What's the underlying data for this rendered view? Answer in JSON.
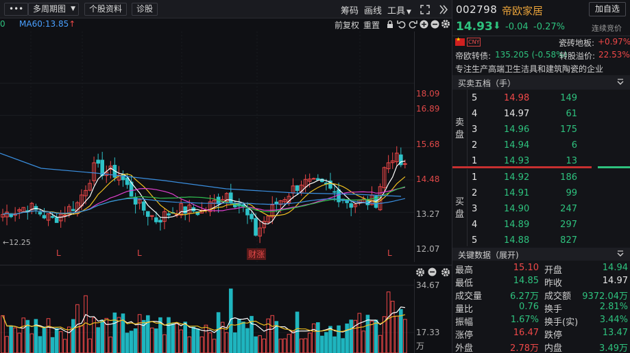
{
  "toolbar": {
    "menu_label": "•••",
    "period_label": "多周期图",
    "profile_label": "个股资料",
    "diagnose_label": "诊股",
    "chip_label": "筹码",
    "draw_label": "画线",
    "tools_label": "工具"
  },
  "ma_bar": {
    "ma_prev": "0",
    "ma60": "MA60:13.85"
  },
  "subbar": {
    "restore": "前复权",
    "reset": "重置"
  },
  "price_axis": [
    "18.09",
    "16.89",
    "15.68",
    "14.48",
    "13.27",
    "12.07"
  ],
  "low_marker": "←12.25",
  "event_markers": [
    "L",
    "L",
    "财涨",
    "L"
  ],
  "volume_axis": [
    "34.67",
    "17.33",
    "万"
  ],
  "quote": {
    "code": "002798",
    "name": "帝欧家居",
    "price": "14.93",
    "change": "-0.04",
    "change_pct": "-0.27%",
    "add_button": "加自选",
    "auction": "连续竞价",
    "sector_label": "瓷砖地板:",
    "sector_change": "+0.97%",
    "currency": "CNY",
    "bond_label": "帝欧转债:",
    "bond_value": "135.205 (-0.58%)",
    "premium_label": "转股溢价:",
    "premium_value": "22.53%",
    "desc": "专注生产高端卫生洁具和建筑陶瓷的企业"
  },
  "orderbook": {
    "title": "买卖五档（手）",
    "sell_label": "卖盘",
    "buy_label": "买盘",
    "sell": [
      {
        "lvl": "5",
        "price": "14.98",
        "vol": "149",
        "pc": "red"
      },
      {
        "lvl": "4",
        "price": "14.97",
        "vol": "61",
        "pc": "wht"
      },
      {
        "lvl": "3",
        "price": "14.96",
        "vol": "175",
        "pc": "grn"
      },
      {
        "lvl": "2",
        "price": "14.94",
        "vol": "6",
        "pc": "grn"
      },
      {
        "lvl": "1",
        "price": "14.93",
        "vol": "13",
        "pc": "grn"
      }
    ],
    "buy": [
      {
        "lvl": "1",
        "price": "14.92",
        "vol": "186",
        "pc": "grn"
      },
      {
        "lvl": "2",
        "price": "14.91",
        "vol": "99",
        "pc": "grn"
      },
      {
        "lvl": "3",
        "price": "14.90",
        "vol": "247",
        "pc": "grn"
      },
      {
        "lvl": "4",
        "price": "14.89",
        "vol": "297",
        "pc": "grn"
      },
      {
        "lvl": "5",
        "price": "14.88",
        "vol": "827",
        "pc": "grn"
      }
    ]
  },
  "keydata": {
    "title": "关键数据（展开)",
    "rows": [
      {
        "k1": "最高",
        "v1": "15.10",
        "c1": "red",
        "k2": "开盘",
        "v2": "14.94",
        "c2": "grn"
      },
      {
        "k1": "最低",
        "v1": "14.85",
        "c1": "grn",
        "k2": "昨收",
        "v2": "14.97",
        "c2": "wht"
      },
      {
        "k1": "成交量",
        "v1": "6.27万",
        "c1": "grn",
        "k2": "成交额",
        "v2": "9372.04万",
        "c2": "grn"
      },
      {
        "k1": "量比",
        "v1": "0.76",
        "c1": "grn",
        "k2": "换手",
        "v2": "2.81%",
        "c2": "grn"
      },
      {
        "k1": "振幅",
        "v1": "1.67%",
        "c1": "grn",
        "k2": "换手(实)",
        "v2": "3.44%",
        "c2": "grn"
      },
      {
        "k1": "涨停",
        "v1": "16.47",
        "c1": "red",
        "k2": "跌停",
        "v2": "13.47",
        "c2": "grn"
      },
      {
        "k1": "外盘",
        "v1": "2.78万",
        "c1": "red",
        "k2": "内盘",
        "v2": "3.49万",
        "c2": "grn"
      }
    ]
  },
  "colors": {
    "up": "#f04848",
    "down": "#2ec27e",
    "bg": "#0f1014",
    "panel": "#131418"
  }
}
